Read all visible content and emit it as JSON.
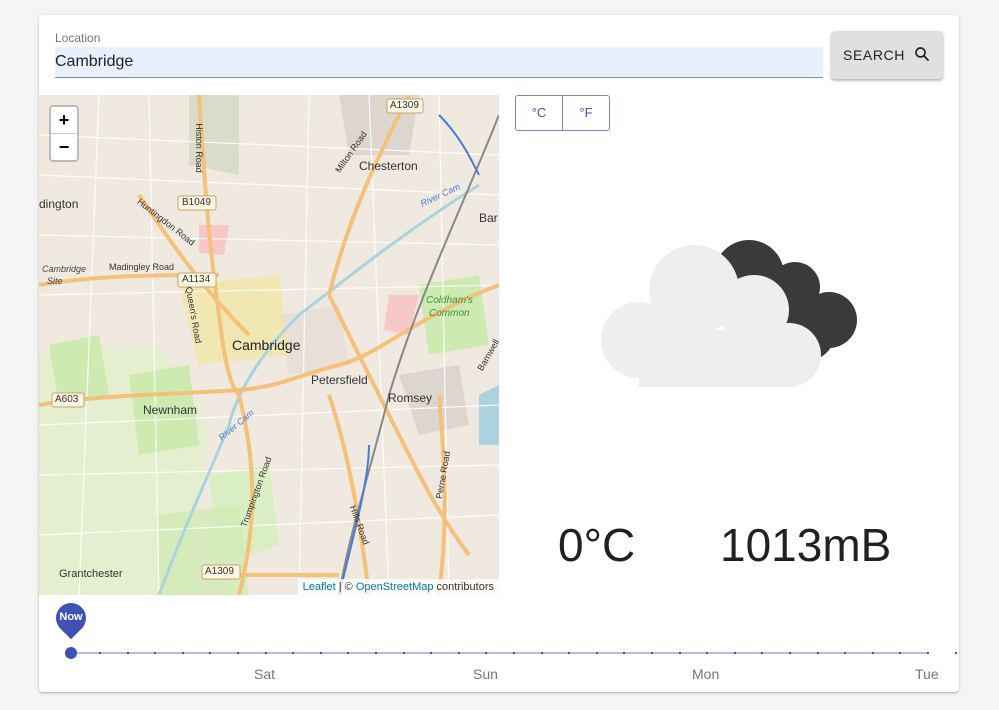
{
  "search": {
    "label": "Location",
    "value": "Cambridge",
    "button_label": "SEARCH",
    "button_icon": "search-icon"
  },
  "map": {
    "zoom_in": "+",
    "zoom_out": "−",
    "attribution_link": "Leaflet",
    "attribution_sep": " | © ",
    "attribution_osm": "OpenStreetMap",
    "attribution_tail": " contributors",
    "labels": {
      "city": "Cambridge",
      "chesterton": "Chesterton",
      "petersfield": "Petersfield",
      "romsey": "Romsey",
      "newnham": "Newnham",
      "grantchester": "Grantchester",
      "girton": "dington",
      "barnwell": "Bar",
      "coldhams": "Coldham's",
      "common": "Common",
      "cambridge_site": "Cambridge",
      "site": "Site",
      "b1049": "B1049",
      "a1134": "A1134",
      "a1309_top": "A1309",
      "a1309_bottom": "A1309",
      "a603": "A603",
      "histon": "Histon Road",
      "huntingdon": "Huntingdon Road",
      "madingley": "Madingley Road",
      "queens": "Queen's Road",
      "milton": "Milton Road",
      "trumpington": "Trumpington Road",
      "hills": "Hills Road",
      "perne": "Perne Road",
      "river_cam_n": "River Cam",
      "river_cam_s": "River Cam",
      "barnwell_road": "Barnwell"
    }
  },
  "units": {
    "celsius": "°C",
    "fahrenheit": "°F"
  },
  "weather": {
    "icon": "partly-cloudy-night-icon",
    "temperature": "0°C",
    "pressure": "1013mB"
  },
  "timeline": {
    "now_label": "Now",
    "days": [
      "Sat",
      "Sun",
      "Mon",
      "Tue"
    ]
  },
  "colors": {
    "accent": "#3f51b5",
    "input_bg": "#e8f0fe",
    "button_bg": "#e0e0e0",
    "map_road": "#f5c07a",
    "map_park": "#cdebb0"
  }
}
